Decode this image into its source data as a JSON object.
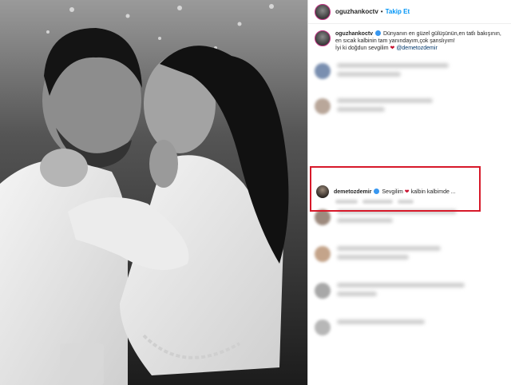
{
  "post": {
    "author": "oguzhankoctv",
    "follow_label": "Takip Et",
    "separator": "•"
  },
  "caption": {
    "author": "oguzhankoctv",
    "text_line1": "Dünyanın en güzel gülüşünün,en tatlı bakışının,",
    "text_line2": "en sıcak kalbinin tam yanındayım,çok şanslıyım!",
    "text_line3_prefix": "İyi ki doğdun sevgilim",
    "mention": "@demetozdemir"
  },
  "highlighted_comment": {
    "author": "demetozdemir",
    "text_prefix": "Sevgilim",
    "text_suffix": "kalbin kalbimde ..."
  },
  "colors": {
    "highlight_border": "#d7192a",
    "follow_blue": "#0095f6",
    "heart_red": "#c8102e"
  },
  "icons": {
    "verified": "verified-badge-icon",
    "heart": "heart-icon"
  }
}
